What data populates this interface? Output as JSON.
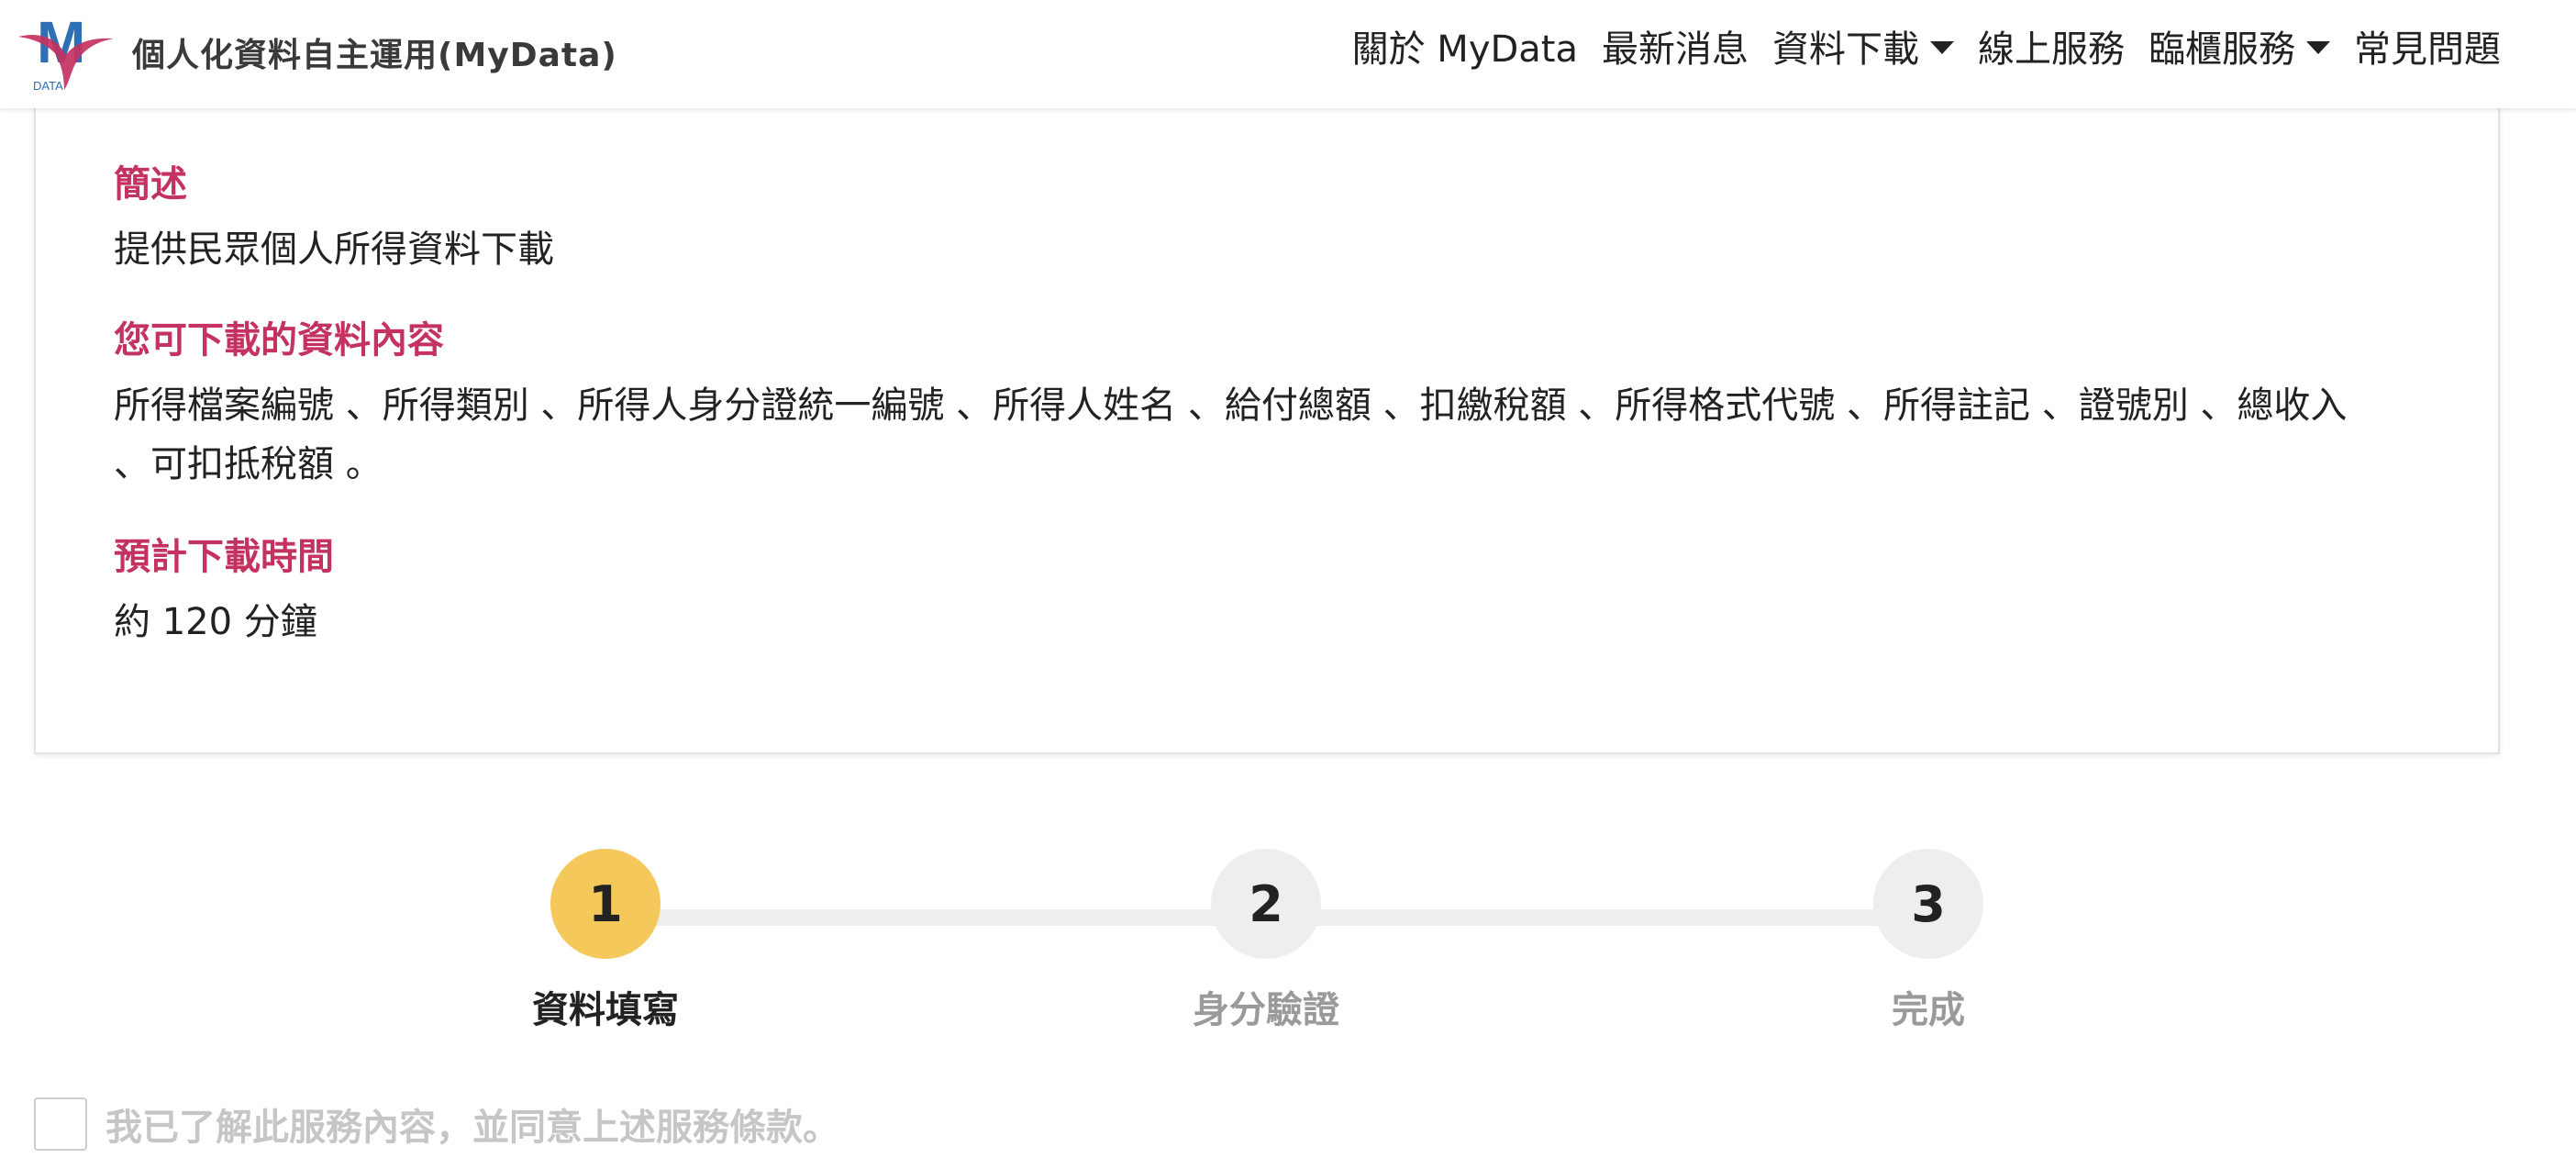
{
  "brand": {
    "title": "個人化資料自主運用(MyData)",
    "logo_text": "M",
    "logo_subtext": "DATA"
  },
  "nav": {
    "items": [
      {
        "label": "關於 MyData",
        "has_dropdown": false
      },
      {
        "label": "最新消息",
        "has_dropdown": false
      },
      {
        "label": "資料下載",
        "has_dropdown": true
      },
      {
        "label": "線上服務",
        "has_dropdown": false
      },
      {
        "label": "臨櫃服務",
        "has_dropdown": true
      },
      {
        "label": "常見問題",
        "has_dropdown": false
      }
    ]
  },
  "card": {
    "summary_title": "簡述",
    "summary_text": "提供民眾個人所得資料下載",
    "content_title": "您可下載的資料內容",
    "content_line1": "所得檔案編號 、所得類別 、所得人身分證統一編號 、所得人姓名 、給付總額 、扣繳稅額 、所得格式代號 、所得註記 、證號別 、總收入",
    "content_line2": "、可扣抵稅額 。",
    "time_title": "預計下載時間",
    "time_text": "約 120 分鐘"
  },
  "steps": {
    "items": [
      {
        "number": "1",
        "label": "資料填寫",
        "state": "active"
      },
      {
        "number": "2",
        "label": "身分驗證",
        "state": "inactive"
      },
      {
        "number": "3",
        "label": "完成",
        "state": "inactive"
      }
    ]
  },
  "agreement": {
    "label": "我已了解此服務內容，並同意上述服務條款。",
    "checked": false
  },
  "colors": {
    "accent_heading": "#c4325f",
    "step_active": "#f5c85b",
    "step_inactive": "#eeeeee",
    "muted_text": "#9a9a9a",
    "logo_blue": "#2f6fb5",
    "logo_red": "#c4325f"
  }
}
